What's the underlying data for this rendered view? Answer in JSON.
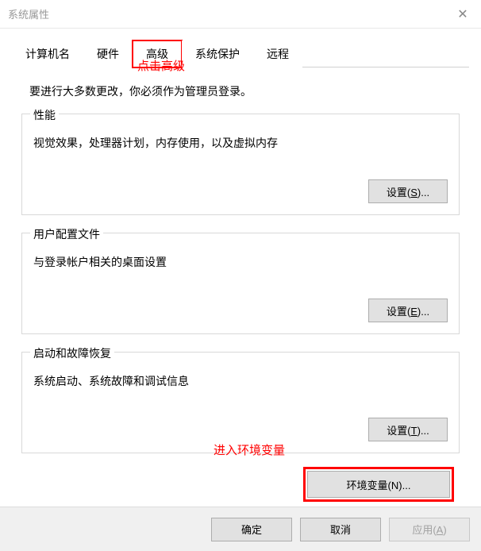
{
  "window": {
    "title": "系统属性"
  },
  "tabs": {
    "computer_name": "计算机名",
    "hardware": "硬件",
    "advanced": "高级",
    "system_protection": "系统保护",
    "remote": "远程"
  },
  "annotations": {
    "click_advanced": "点击高级",
    "enter_env": "进入环境变量"
  },
  "content": {
    "instruction": "要进行大多数更改，你必须作为管理员登录。",
    "performance": {
      "title": "性能",
      "desc": "视觉效果，处理器计划，内存使用，以及虚拟内存"
    },
    "user_profiles": {
      "title": "用户配置文件",
      "desc": "与登录帐户相关的桌面设置"
    },
    "startup": {
      "title": "启动和故障恢复",
      "desc": "系统启动、系统故障和调试信息"
    }
  },
  "buttons": {
    "settings_s_pre": "设置(",
    "settings_s_key": "S",
    "settings_s_post": ")...",
    "settings_e_pre": "设置(",
    "settings_e_key": "E",
    "settings_e_post": ")...",
    "settings_t_pre": "设置(",
    "settings_t_key": "T",
    "settings_t_post": ")...",
    "env_pre": "环境变量(",
    "env_key": "N",
    "env_post": ")...",
    "ok": "确定",
    "cancel": "取消",
    "apply_pre": "应用(",
    "apply_key": "A",
    "apply_post": ")"
  }
}
